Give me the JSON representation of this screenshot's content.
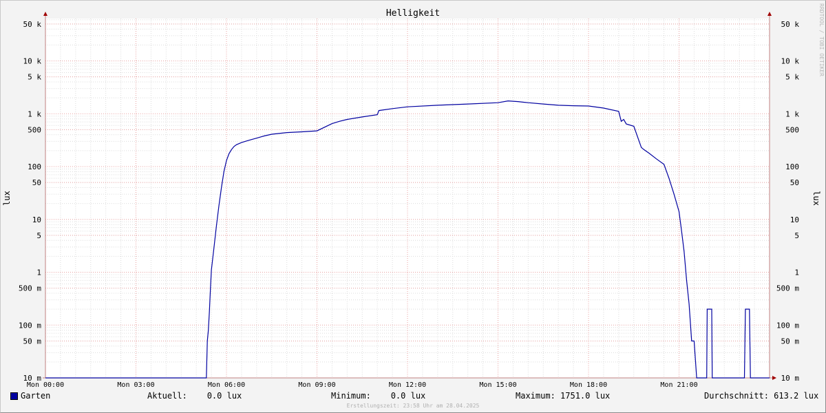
{
  "chart_data": {
    "type": "line",
    "title": "Helligkeit",
    "ylabel": "lux",
    "y_scale": "log",
    "ylim": [
      0.01,
      70000
    ],
    "y_ticks": [
      {
        "value": 50000,
        "label": "50 k"
      },
      {
        "value": 10000,
        "label": "10 k"
      },
      {
        "value": 5000,
        "label": "5 k"
      },
      {
        "value": 1000,
        "label": "1 k"
      },
      {
        "value": 500,
        "label": "500"
      },
      {
        "value": 100,
        "label": "100"
      },
      {
        "value": 50,
        "label": "50"
      },
      {
        "value": 10,
        "label": "10"
      },
      {
        "value": 5,
        "label": "5"
      },
      {
        "value": 1,
        "label": "1"
      },
      {
        "value": 0.5,
        "label": "500 m"
      },
      {
        "value": 0.1,
        "label": "100 m"
      },
      {
        "value": 0.05,
        "label": "50 m"
      },
      {
        "value": 0.01,
        "label": "10 m"
      }
    ],
    "xlim": [
      "00:00",
      "24:00"
    ],
    "x_ticks": [
      {
        "value": "00:00",
        "label": "Mon 00:00"
      },
      {
        "value": "03:00",
        "label": "Mon 03:00"
      },
      {
        "value": "06:00",
        "label": "Mon 06:00"
      },
      {
        "value": "09:00",
        "label": "Mon 09:00"
      },
      {
        "value": "12:00",
        "label": "Mon 12:00"
      },
      {
        "value": "15:00",
        "label": "Mon 15:00"
      },
      {
        "value": "18:00",
        "label": "Mon 18:00"
      },
      {
        "value": "21:00",
        "label": "Mon 21:00"
      }
    ],
    "grid": true,
    "legend_position": "bottom-left",
    "series": [
      {
        "name": "Garten",
        "color": "#0000a0",
        "x": [
          "00:00",
          "05:20",
          "05:22",
          "05:24",
          "05:26",
          "05:28",
          "05:30",
          "05:35",
          "05:40",
          "05:45",
          "05:50",
          "05:55",
          "06:00",
          "06:05",
          "06:10",
          "06:15",
          "06:20",
          "06:30",
          "06:40",
          "06:50",
          "07:00",
          "07:15",
          "07:30",
          "08:00",
          "08:30",
          "09:00",
          "09:30",
          "09:45",
          "10:00",
          "10:30",
          "11:00",
          "11:03",
          "11:30",
          "12:00",
          "13:00",
          "14:00",
          "15:00",
          "15:20",
          "15:40",
          "16:00",
          "16:30",
          "17:00",
          "17:30",
          "18:00",
          "18:30",
          "19:00",
          "19:05",
          "19:10",
          "19:15",
          "19:30",
          "19:45",
          "19:50",
          "20:00",
          "20:15",
          "20:30",
          "20:40",
          "20:50",
          "21:00",
          "21:05",
          "21:10",
          "21:15",
          "21:20",
          "21:25",
          "21:30",
          "21:35",
          "21:40",
          "21:45",
          "21:50",
          "21:55",
          "21:56",
          "22:05",
          "22:06",
          "22:10",
          "22:15",
          "23:10",
          "23:12",
          "23:20",
          "23:22",
          "23:55",
          "23:56",
          "24:00"
        ],
        "values": [
          0.01,
          0.01,
          0.05,
          0.08,
          0.18,
          0.45,
          1.1,
          2.8,
          7.5,
          18,
          40,
          80,
          130,
          175,
          210,
          240,
          260,
          285,
          305,
          325,
          345,
          380,
          410,
          440,
          455,
          475,
          650,
          720,
          780,
          870,
          960,
          1150,
          1250,
          1350,
          1450,
          1530,
          1620,
          1751,
          1700,
          1620,
          1530,
          1450,
          1420,
          1400,
          1280,
          1110,
          720,
          780,
          640,
          580,
          230,
          210,
          180,
          140,
          110,
          60,
          30,
          14,
          6,
          2.5,
          0.7,
          0.25,
          0.05,
          0.05,
          0.01,
          0.01,
          0.01,
          0.01,
          0.01,
          0.2,
          0.2,
          0.01,
          0.01,
          0.01,
          0.01,
          0.2,
          0.2,
          0.01,
          0.01,
          0.01,
          0.01
        ]
      }
    ]
  },
  "watermark": "RRDTOOL / TOBI OETIKER",
  "legend": {
    "series_name": "Garten",
    "swatch_color": "#0000a0",
    "aktuell": "Aktuell:    0.0 lux",
    "minimum": "Minimum:    0.0 lux",
    "maximum": "Maximum: 1751.0 lux",
    "durchschnitt": "Durchschnitt: 613.2 lux"
  },
  "footer": "Erstellungszeit: 23:58 Uhr am 28.04.2025"
}
